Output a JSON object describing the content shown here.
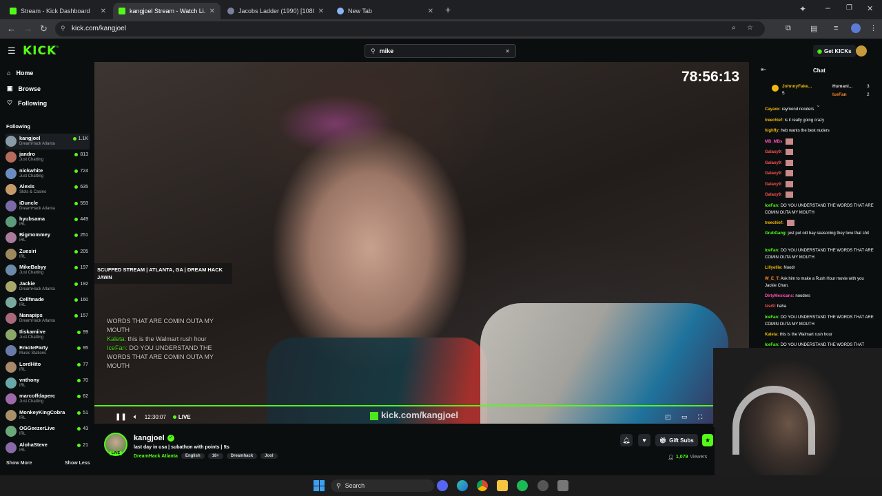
{
  "browser": {
    "tabs": [
      {
        "title": "Stream - Kick Dashboard",
        "active": false
      },
      {
        "title": "kangjoel Stream - Watch Li...",
        "active": true
      },
      {
        "title": "Jacobs Ladder (1990) [1080p]...",
        "active": false
      },
      {
        "title": "New Tab",
        "active": false
      }
    ],
    "url": "kick.com/kangjoel"
  },
  "header": {
    "logo": "KICK",
    "logo_badge": "BETA",
    "search_value": "mike",
    "get_kicks_label": "Get KICKs"
  },
  "sidebar": {
    "nav": [
      {
        "label": "Home",
        "icon": "home-icon"
      },
      {
        "label": "Browse",
        "icon": "browse-icon"
      },
      {
        "label": "Following",
        "icon": "heart-icon"
      }
    ],
    "following_heading": "Following",
    "following": [
      {
        "name": "kangjoel",
        "category": "DreamHack Atlanta",
        "viewers": "1.1K"
      },
      {
        "name": "jandro",
        "category": "Just Chatting",
        "viewers": "813"
      },
      {
        "name": "nickwhite",
        "category": "Just Chatting",
        "viewers": "724"
      },
      {
        "name": "Alexis",
        "category": "Slots & Casino",
        "viewers": "635"
      },
      {
        "name": "iDuncle",
        "category": "DreamHack Atlanta",
        "viewers": "593"
      },
      {
        "name": "hyubsama",
        "category": "IRL",
        "viewers": "449"
      },
      {
        "name": "Bigmommey",
        "category": "IRL",
        "viewers": "251"
      },
      {
        "name": "Zuesiri",
        "category": "IRL",
        "viewers": "205"
      },
      {
        "name": "MikeBabyy",
        "category": "Just Chatting",
        "viewers": "197"
      },
      {
        "name": "Jackie",
        "category": "DreamHack Atlanta",
        "viewers": "192"
      },
      {
        "name": "Cellfmade",
        "category": "IRL",
        "viewers": "160"
      },
      {
        "name": "Nanapips",
        "category": "DreamHack Atlanta",
        "viewers": "157"
      },
      {
        "name": "Iliskamiive",
        "category": "Just Chatting",
        "viewers": "99"
      },
      {
        "name": "EmoteParty",
        "category": "Music Stations",
        "viewers": "95"
      },
      {
        "name": "LordHito",
        "category": "IRL",
        "viewers": "77"
      },
      {
        "name": "vnthony",
        "category": "IRL",
        "viewers": "70"
      },
      {
        "name": "marcoffdaperc",
        "category": "Just Chatting",
        "viewers": "62"
      },
      {
        "name": "MonkeyKingCobra",
        "category": "IRL",
        "viewers": "51"
      },
      {
        "name": "OGGeezerLive",
        "category": "IRL",
        "viewers": "43"
      },
      {
        "name": "AlohaSteve",
        "category": "IRL",
        "viewers": "21"
      }
    ],
    "show_more": "Show More",
    "show_less": "Show Less"
  },
  "video": {
    "timer": "78:56:13",
    "overlay_title": "SCUFFED STREAM | ATLANTA, GA | DREAM HACK JAWN",
    "overlay_chat": [
      {
        "user": "",
        "text": "WORDS THAT ARE COMIN OUTA MY MOUTH"
      },
      {
        "user": "Kaleta:",
        "text": "this is the Walmart rush hour"
      },
      {
        "user": "IceFan:",
        "text": "DO YOU UNDERSTAND THE WORDS THAT ARE COMIN OUTA MY MOUTH"
      }
    ],
    "elapsed": "12:30:07",
    "live_label": "LIVE",
    "watermark": "kick.com/kangjoel"
  },
  "chat": {
    "title": "Chat",
    "top_gifters": [
      {
        "name": "JohnnyFake...",
        "count": "5"
      },
      {
        "name": "Humani...",
        "count": "3"
      },
      {
        "name": "IceFan",
        "count": "2"
      }
    ],
    "messages": [
      {
        "user": "Cayaxx:",
        "text": "raymond nooders",
        "color": "#f0b90b"
      },
      {
        "user": "treechief:",
        "text": "is it really going crazy",
        "color": "#f0b90b"
      },
      {
        "user": "highfly:",
        "text": "heb wants the best nuders",
        "color": "#f0b90b"
      },
      {
        "user": "MB_MBs",
        "text": "",
        "color": "#ff4fb0"
      },
      {
        "user": "Galaxy9:",
        "text": "",
        "color": "#ff5252"
      },
      {
        "user": "Galaxy9:",
        "text": "",
        "color": "#ff5252"
      },
      {
        "user": "Galaxy9:",
        "text": "",
        "color": "#ff5252"
      },
      {
        "user": "Galaxy9:",
        "text": "",
        "color": "#ff5252"
      },
      {
        "user": "Galaxy9:",
        "text": "",
        "color": "#ff5252"
      },
      {
        "user": "IceFan:",
        "text": "DO YOU UNDERSTAND THE WORDS THAT ARE COMIN OUTA MY MOUTH",
        "color": "#53fc18"
      },
      {
        "user": "treechief:",
        "text": "",
        "color": "#f0b90b"
      },
      {
        "user": "GrubGang:",
        "text": "just put old bay seasoning they love that shit",
        "color": "#53fc18"
      },
      {
        "user": "IceFan:",
        "text": "DO YOU UNDERSTAND THE WORDS THAT ARE COMIN OUTA MY MOUTH",
        "color": "#53fc18"
      },
      {
        "user": "Lillyellie:",
        "text": "Noodr",
        "color": "#f0b90b"
      },
      {
        "user": "W_E_T:",
        "text": "Ask him to make a Rush Hour movie with you Jackie Chan.",
        "color": "#ff8a2a"
      },
      {
        "user": "DirtyMexicans:",
        "text": "nooders",
        "color": "#ff4fb0"
      },
      {
        "user": "tzsr9:",
        "text": "haha",
        "color": "#ff5252"
      },
      {
        "user": "IceFan:",
        "text": "DO YOU UNDERSTAND THE WORDS THAT ARE COMIN OUTA MY MOUTH",
        "color": "#53fc18"
      },
      {
        "user": "Kaleta:",
        "text": "this is the Walmart rush hour",
        "color": "#f0b90b"
      },
      {
        "user": "IceFan:",
        "text": "DO YOU UNDERSTAND THE WORDS THAT",
        "color": "#53fc18"
      }
    ]
  },
  "stream": {
    "username": "kangjoel",
    "title": "last day in usa | subathon with points | !ts",
    "live_badge": "LIVE",
    "category": "DreamHack Atlanta",
    "tags": [
      "English",
      "18+",
      "Dreamhack",
      "Jool"
    ],
    "viewers": "1,079",
    "viewers_label": "Viewers",
    "gift_subs_label": "Gift Subs"
  },
  "taskbar": {
    "search_label": "Search"
  },
  "colors": {
    "accent": "#53fc18",
    "background": "#0b0e0f"
  }
}
